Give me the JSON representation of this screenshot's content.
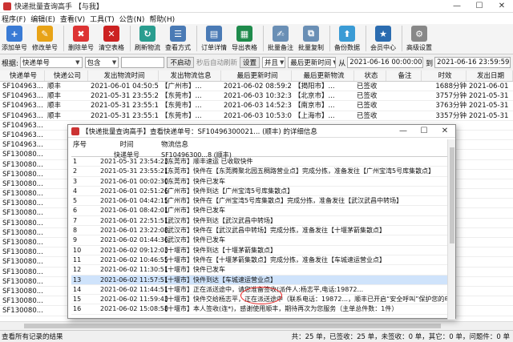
{
  "window": {
    "title": "快递批量查询高手 【与我】",
    "min": "—",
    "max": "☐",
    "close": "✕"
  },
  "menu": [
    "程序(F)",
    "编辑(E)",
    "查看(V)",
    "工具(T)",
    "公告(N)",
    "帮助(H)"
  ],
  "toolbar": [
    {
      "label": "添加单号",
      "icon": "add-icon",
      "color": "#3a7bd5",
      "glyph": "+"
    },
    {
      "label": "修改单号",
      "icon": "edit-icon",
      "color": "#e8a317",
      "glyph": "✎"
    },
    {
      "label": "删除单号",
      "icon": "delete-icon",
      "color": "#d33",
      "glyph": "✖"
    },
    {
      "label": "清空表格",
      "icon": "clear-icon",
      "color": "#c22",
      "glyph": "✕"
    },
    {
      "label": "刷新物流",
      "icon": "refresh-icon",
      "color": "#2a9d8f",
      "glyph": "↻"
    },
    {
      "label": "查看方式",
      "icon": "view-icon",
      "color": "#4a7ab5",
      "glyph": "☰"
    },
    {
      "label": "订单详情",
      "icon": "detail-icon",
      "color": "#4a7ab5",
      "glyph": "▤"
    },
    {
      "label": "导出表格",
      "icon": "export-icon",
      "color": "#1f8b4c",
      "glyph": "▦"
    },
    {
      "label": "批量备注",
      "icon": "note-icon",
      "color": "#6a8fb5",
      "glyph": "✍"
    },
    {
      "label": "批量复制",
      "icon": "copy-icon",
      "color": "#6a8fb5",
      "glyph": "⧉"
    },
    {
      "label": "备份数据",
      "icon": "backup-icon",
      "color": "#3a9bd5",
      "glyph": "⬆"
    },
    {
      "label": "会员中心",
      "icon": "member-icon",
      "color": "#2b6cb0",
      "glyph": "★"
    },
    {
      "label": "高级设置",
      "icon": "settings-icon",
      "color": "#888",
      "glyph": "⚙"
    }
  ],
  "filter": {
    "label_root": "根据:",
    "field": "快递单号",
    "match": "包含",
    "start_btn": "不启动",
    "timer_text": "秒后自动刷新",
    "settings_btn": "设置",
    "and_or": "并且",
    "time_field": "最后更新时间",
    "from_label": "从",
    "from_value": "2021-06-16 00:00:00",
    "to_label": "到",
    "to_value": "2021-06-16 23:59:59"
  },
  "grid": {
    "headers": [
      "快递单号",
      "快递公司",
      "发出物流时间",
      "发出物流信息",
      "最后更新时间",
      "最后更新物流",
      "状态",
      "备注",
      "时效",
      "发出日期",
      "发出时间"
    ],
    "rows": [
      [
        "SF104963...",
        "顺丰",
        "2021-06-01 04:50:59",
        "【广州市】...",
        "2021-06-02 08:59:21",
        "【揭阳市】...",
        "已签收",
        "",
        "1688分钟",
        "2021-06-01",
        "04:50"
      ],
      [
        "SF104963...",
        "顺丰",
        "2021-05-31 23:55:21",
        "【东莞市】...",
        "2021-06-03 10:32:39",
        "【北京市】...",
        "已签收",
        "",
        "3757分钟",
        "2021-05-31",
        "23:55"
      ],
      [
        "SF104963...",
        "顺丰",
        "2021-05-31 23:55:18",
        "【东莞市】...",
        "2021-06-03 14:52:39",
        "【南京市】...",
        "已签收",
        "",
        "3763分钟",
        "2021-05-31",
        "23:55"
      ],
      [
        "SF104963...",
        "顺丰",
        "2021-05-31 23:55:18",
        "【东莞市】...",
        "2021-06-03 10:53:01",
        "【上海市】...",
        "已签收",
        "",
        "3357分钟",
        "2021-05-31",
        "23:55"
      ],
      [
        "SF104963...",
        "",
        "",
        "",
        "",
        "",
        "",
        "",
        "",
        "",
        ""
      ],
      [
        "SF104963...",
        "",
        "",
        "",
        "",
        "",
        "",
        "",
        "",
        "",
        ""
      ],
      [
        "SF104963...",
        "",
        "",
        "",
        "",
        "",
        "",
        "",
        "",
        "",
        ""
      ],
      [
        "SF130080...",
        "",
        "",
        "",
        "",
        "",
        "",
        "",
        "",
        "",
        ""
      ],
      [
        "SF130080...",
        "",
        "",
        "",
        "",
        "",
        "",
        "",
        "",
        "",
        ""
      ],
      [
        "SF130080...",
        "",
        "",
        "",
        "",
        "",
        "",
        "",
        "",
        "",
        ""
      ],
      [
        "SF130080...",
        "",
        "",
        "",
        "",
        "",
        "",
        "",
        "",
        "",
        ""
      ],
      [
        "SF130080...",
        "",
        "",
        "",
        "",
        "",
        "",
        "",
        "",
        "",
        ""
      ],
      [
        "SF130080...",
        "",
        "",
        "",
        "",
        "",
        "",
        "",
        "",
        "",
        ""
      ],
      [
        "SF130080...",
        "",
        "",
        "",
        "",
        "",
        "",
        "",
        "",
        "",
        ""
      ],
      [
        "SF130080...",
        "",
        "",
        "",
        "",
        "",
        "",
        "",
        "",
        "",
        ""
      ],
      [
        "SF130080...",
        "",
        "",
        "",
        "",
        "",
        "",
        "",
        "",
        "",
        ""
      ],
      [
        "SF130080...",
        "",
        "",
        "",
        "",
        "",
        "",
        "",
        "",
        "",
        ""
      ],
      [
        "SF130080...",
        "",
        "",
        "",
        "",
        "",
        "",
        "",
        "",
        "",
        ""
      ],
      [
        "SF130080...",
        "",
        "",
        "",
        "",
        "",
        "",
        "",
        "",
        "",
        ""
      ],
      [
        "SF130080...",
        "",
        "",
        "",
        "",
        "",
        "",
        "",
        "",
        "",
        ""
      ],
      [
        "SF130080...",
        "",
        "",
        "",
        "",
        "",
        "",
        "",
        "",
        "",
        ""
      ],
      [
        "SF130080...",
        "",
        "",
        "",
        "",
        "",
        "",
        "",
        "",
        "",
        ""
      ],
      [
        "SF130080...",
        "",
        "",
        "",
        "",
        "",
        "",
        "",
        "",
        "",
        ""
      ],
      [
        "SF130080...",
        "",
        "",
        "",
        "",
        "",
        "",
        "",
        "",
        "",
        ""
      ]
    ]
  },
  "dialog": {
    "title": "【快递批量查询高手】查看快递单号：SF10496300021... (顺丰) 的详细信息",
    "col_index": "序号",
    "col_time": "时间",
    "col_info": "物流信息",
    "sub_time": "快递单号",
    "sub_info": "SF10496300...8 (顺丰)",
    "rows": [
      [
        "1",
        "2021-05-31 23:54:23",
        "【东莞市】顺丰速运 已收取快件"
      ],
      [
        "2",
        "2021-05-31 23:55:21",
        "【东莞市】快件在【东莞腾聚北园五稠路营业点】完成分拣，准备发往【广州宝湾5号库集散点】"
      ],
      [
        "3",
        "2021-06-01 00:02:30",
        "【东莞市】快件已发车"
      ],
      [
        "4",
        "2021-06-01 02:51:26",
        "【广州市】快件到达【广州宝湾5号库集散点】"
      ],
      [
        "5",
        "2021-06-01 04:42:15",
        "【广州市】快件在【广州宝湾5号库集散点】完成分拣，准备发往【武汉武昌中转场】"
      ],
      [
        "6",
        "2021-06-01 08:42:01",
        "【广州市】快件已发车"
      ],
      [
        "7",
        "2021-06-01 22:51:51",
        "【武汉市】快件到达【武汉武昌中转场】"
      ],
      [
        "8",
        "2021-06-01 23:22:08",
        "【武汉市】快件在【武汉武昌中转场】完成分拣，准备发往【十堰茅箭集散点】"
      ],
      [
        "9",
        "2021-06-02 01:44:36",
        "【武汉市】快件已发车"
      ],
      [
        "10",
        "2021-06-02 09:12:03",
        "【十堰市】快件到达【十堰茅箭集散点】"
      ],
      [
        "11",
        "2021-06-02 10:46:55",
        "【十堰市】快件在【十堰茅箭集散点】完成分拣，准备发往【车城速运营业点】"
      ],
      [
        "12",
        "2021-06-02 11:30:51",
        "【十堰市】快件已发车"
      ],
      [
        "13",
        "2021-06-02 11:57:51",
        "【十堰市】快件到达【车城速运营业点】"
      ],
      [
        "14",
        "2021-06-02 11:44:51",
        "【十堰市】正在派送途中，请您准备签收(派件人:杨志平,电话:19872..."
      ],
      [
        "15",
        "2021-06-02 11:59:43",
        "【十堰市】快件交给杨志平，正在派送途中（联系电话：19872...，顺丰已开启“安全呼叫”保护您的电..."
      ],
      [
        "16",
        "2021-06-02 15:08:58",
        "【十堰市】本人签收(连*)，感谢使用顺丰，期待再次为您服务（主单总件数：1件）"
      ]
    ]
  },
  "status": {
    "left": "查看所有记录的结果",
    "right": "共：25 单，已签收：25 单，未签收：0 单，其它：0 单，问题件：0 单"
  }
}
